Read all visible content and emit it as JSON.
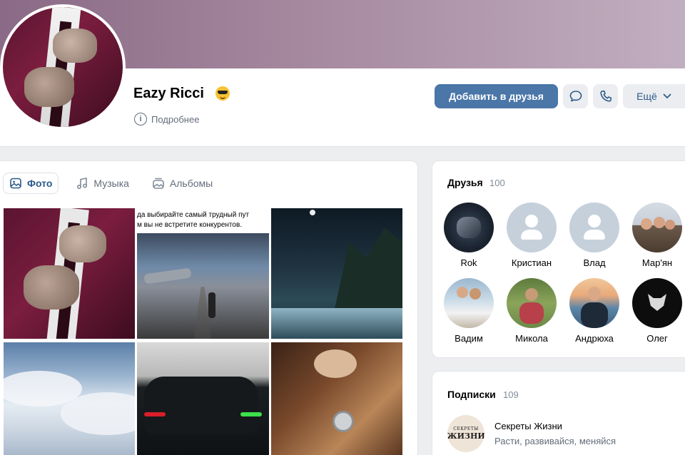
{
  "profile": {
    "name": "Eazy Ricci",
    "more_info": "Подробнее"
  },
  "actions": {
    "add_friend": "Добавить в друзья",
    "more": "Ещё"
  },
  "tabs": [
    {
      "label": "Фото",
      "icon": "photo-icon",
      "active": true
    },
    {
      "label": "Музыка",
      "icon": "music-icon",
      "active": false
    },
    {
      "label": "Альбомы",
      "icon": "albums-icon",
      "active": false
    }
  ],
  "photos": {
    "caption_line1": "да выбирайте самый трудный пут",
    "caption_line2": "м вы не встретите конкурентов."
  },
  "friends": {
    "title": "Друзья",
    "count": "100",
    "items": [
      {
        "name": "Rok"
      },
      {
        "name": "Кристиан"
      },
      {
        "name": "Влад"
      },
      {
        "name": "Мар'ян"
      },
      {
        "name": "Вадим"
      },
      {
        "name": "Микола"
      },
      {
        "name": "Андрюха"
      },
      {
        "name": "Олег"
      }
    ]
  },
  "subscriptions": {
    "title": "Подписки",
    "count": "109",
    "items": [
      {
        "name": "Секреты Жизни",
        "description": "Расти, развивайся, меняйся",
        "logo_line1": "СЕКРЕТЫ",
        "logo_line2": "ЖИЗНИ"
      }
    ]
  },
  "colors": {
    "accent": "#4a76a8",
    "link": "#2c5a8a",
    "secondary_text": "#626d7a",
    "background": "#edeef0"
  }
}
